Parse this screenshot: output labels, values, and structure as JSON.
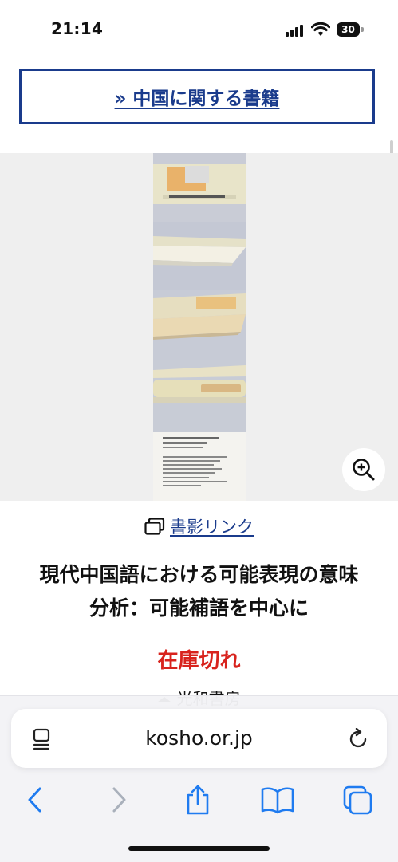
{
  "status_bar": {
    "time": "21:14",
    "battery": "30"
  },
  "china_books_link": "» 中国に関する書籍",
  "thumb_link": "書影リンク",
  "book": {
    "title_line1": "現代中国語における可能表現の意味",
    "title_line2": "分析：可能補語を中心に",
    "stock_status": "在庫切れ",
    "publisher": "光和書房"
  },
  "browser": {
    "url": "kosho.or.jp"
  },
  "colors": {
    "link": "#1a3b8c",
    "out_of_stock": "#d8231d",
    "ios_blue": "#1f7bf0"
  }
}
